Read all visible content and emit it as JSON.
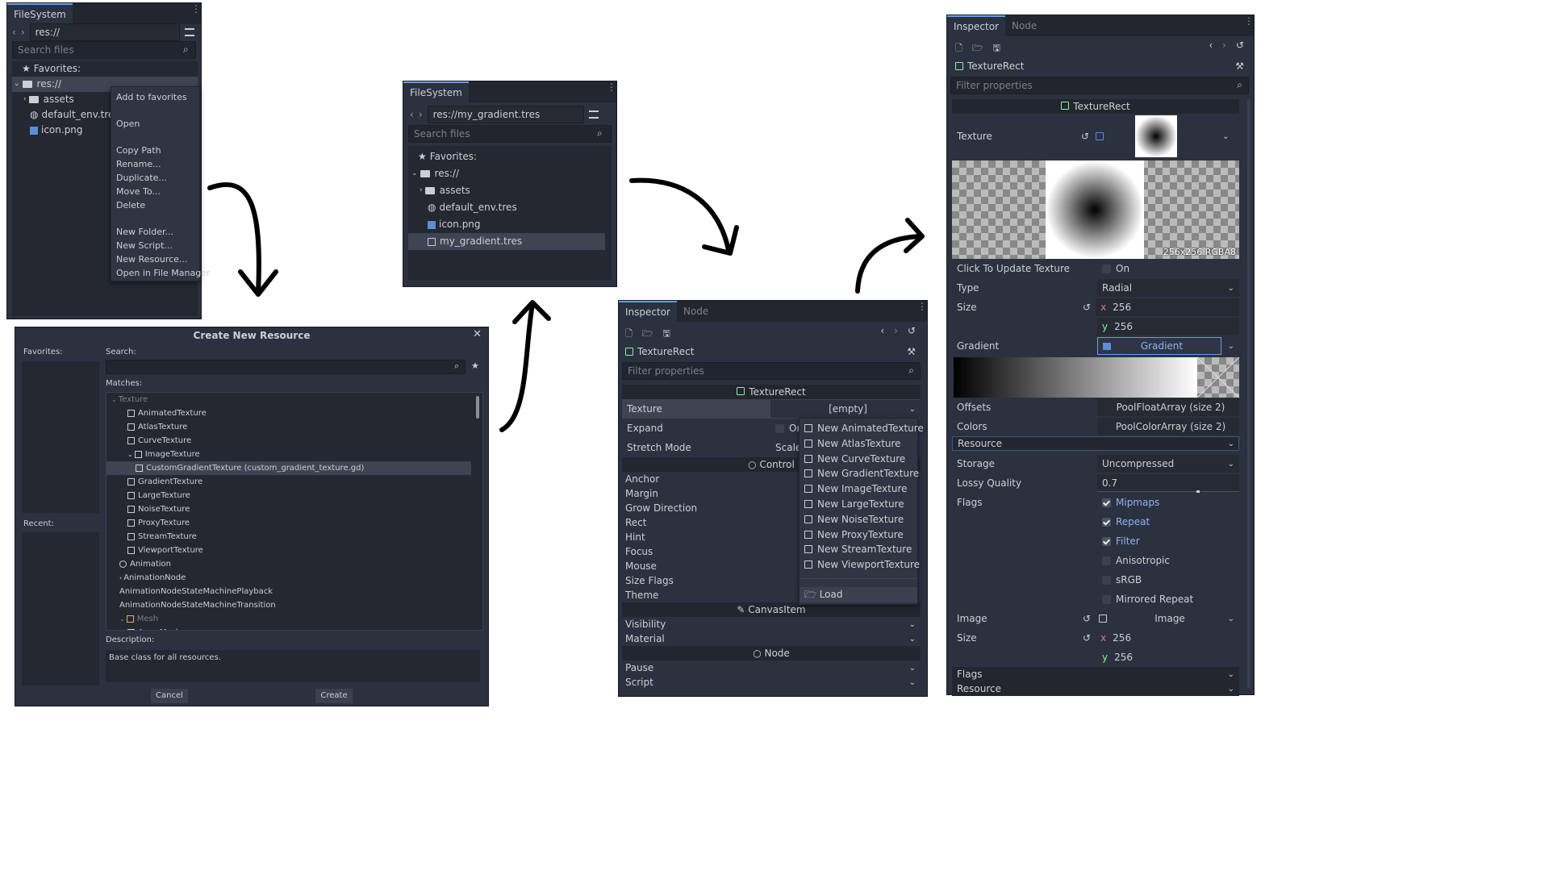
{
  "fs1": {
    "tab": "FileSystem",
    "path": "res://",
    "search_ph": "Search files",
    "favorites": "Favorites:",
    "root": "res://",
    "items": [
      "assets",
      "default_env.tres",
      "icon.png"
    ]
  },
  "ctx": {
    "items": [
      "Add to favorites",
      "Open",
      "Copy Path",
      "Rename...",
      "Duplicate...",
      "Move To...",
      "Delete",
      "New Folder...",
      "New Script...",
      "New Resource...",
      "Open in File Manager"
    ]
  },
  "dialog": {
    "title": "Create New Resource",
    "favorites": "Favorites:",
    "recent": "Recent:",
    "search": "Search:",
    "matches": "Matches:",
    "description_label": "Description:",
    "description": "Base class for all resources.",
    "cancel": "Cancel",
    "create": "Create",
    "tree": [
      "Texture",
      "AnimatedTexture",
      "AtlasTexture",
      "CurveTexture",
      "ImageTexture",
      "CustomGradientTexture (custom_gradient_texture.gd)",
      "GradientTexture",
      "LargeTexture",
      "NoiseTexture",
      "ProxyTexture",
      "StreamTexture",
      "ViewportTexture",
      "Animation",
      "AnimationNode",
      "AnimationNodeStateMachinePlayback",
      "AnimationNodeStateMachineTransition",
      "Mesh",
      "ArrayMesh"
    ]
  },
  "fs2": {
    "tab": "FileSystem",
    "path": "res://my_gradient.tres",
    "search_ph": "Search files",
    "favorites": "Favorites:",
    "root": "res://",
    "items": [
      "assets",
      "default_env.tres",
      "icon.png",
      "my_gradient.tres"
    ]
  },
  "insp1": {
    "tab": "Inspector",
    "tab2": "Node",
    "node": "TextureRect",
    "filter_ph": "Filter properties",
    "section": "TextureRect",
    "texture_label": "Texture",
    "texture_value": "[empty]",
    "expand": "Expand",
    "expand_val": "On",
    "stretch": "Stretch Mode",
    "stretch_val": "Scale",
    "control": "Control",
    "control_rows": [
      "Anchor",
      "Margin",
      "Grow Direction",
      "Rect",
      "Hint",
      "Focus",
      "Mouse",
      "Size Flags",
      "Theme"
    ],
    "canvas": "CanvasItem",
    "canvas_rows": [
      "Visibility",
      "Material"
    ],
    "nodesec": "Node",
    "node_rows": [
      "Pause",
      "Script"
    ],
    "menu": [
      "New AnimatedTexture",
      "New AtlasTexture",
      "New CurveTexture",
      "New GradientTexture",
      "New ImageTexture",
      "New LargeTexture",
      "New NoiseTexture",
      "New ProxyTexture",
      "New StreamTexture",
      "New ViewportTexture"
    ],
    "load": "Load"
  },
  "insp2": {
    "tab": "Inspector",
    "tab2": "Node",
    "node": "TextureRect",
    "filter_ph": "Filter properties",
    "section": "TextureRect",
    "texture_label": "Texture",
    "size_caption": "256x256 RGBA8",
    "click_update": "Click To Update Texture",
    "click_val": "On",
    "type": "Type",
    "type_val": "Radial",
    "size": "Size",
    "x": "x",
    "y": "y",
    "size_x": "256",
    "size_y": "256",
    "gradient": "Gradient",
    "gradient_val": "Gradient",
    "offsets": "Offsets",
    "offsets_val": "PoolFloatArray (size 2)",
    "colors": "Colors",
    "colors_val": "PoolColorArray (size 2)",
    "resource": "Resource",
    "storage": "Storage",
    "storage_val": "Uncompressed",
    "lossy": "Lossy Quality",
    "lossy_val": "0.7",
    "lossy_fraction": 0.7,
    "flags": "Flags",
    "flag_items": [
      {
        "label": "Mipmaps",
        "on": true
      },
      {
        "label": "Repeat",
        "on": true
      },
      {
        "label": "Filter",
        "on": true
      },
      {
        "label": "Anisotropic",
        "on": false
      },
      {
        "label": "sRGB",
        "on": false
      },
      {
        "label": "Mirrored Repeat",
        "on": false
      }
    ],
    "image": "Image",
    "image_val": "Image",
    "size2": "Size",
    "size2_x": "256",
    "size2_y": "256",
    "flags2": "Flags",
    "resource2": "Resource"
  },
  "colors": {
    "panel": "#2c3140",
    "header": "#22262f",
    "accent": "#699ce8",
    "text": "#cdcfd2"
  }
}
